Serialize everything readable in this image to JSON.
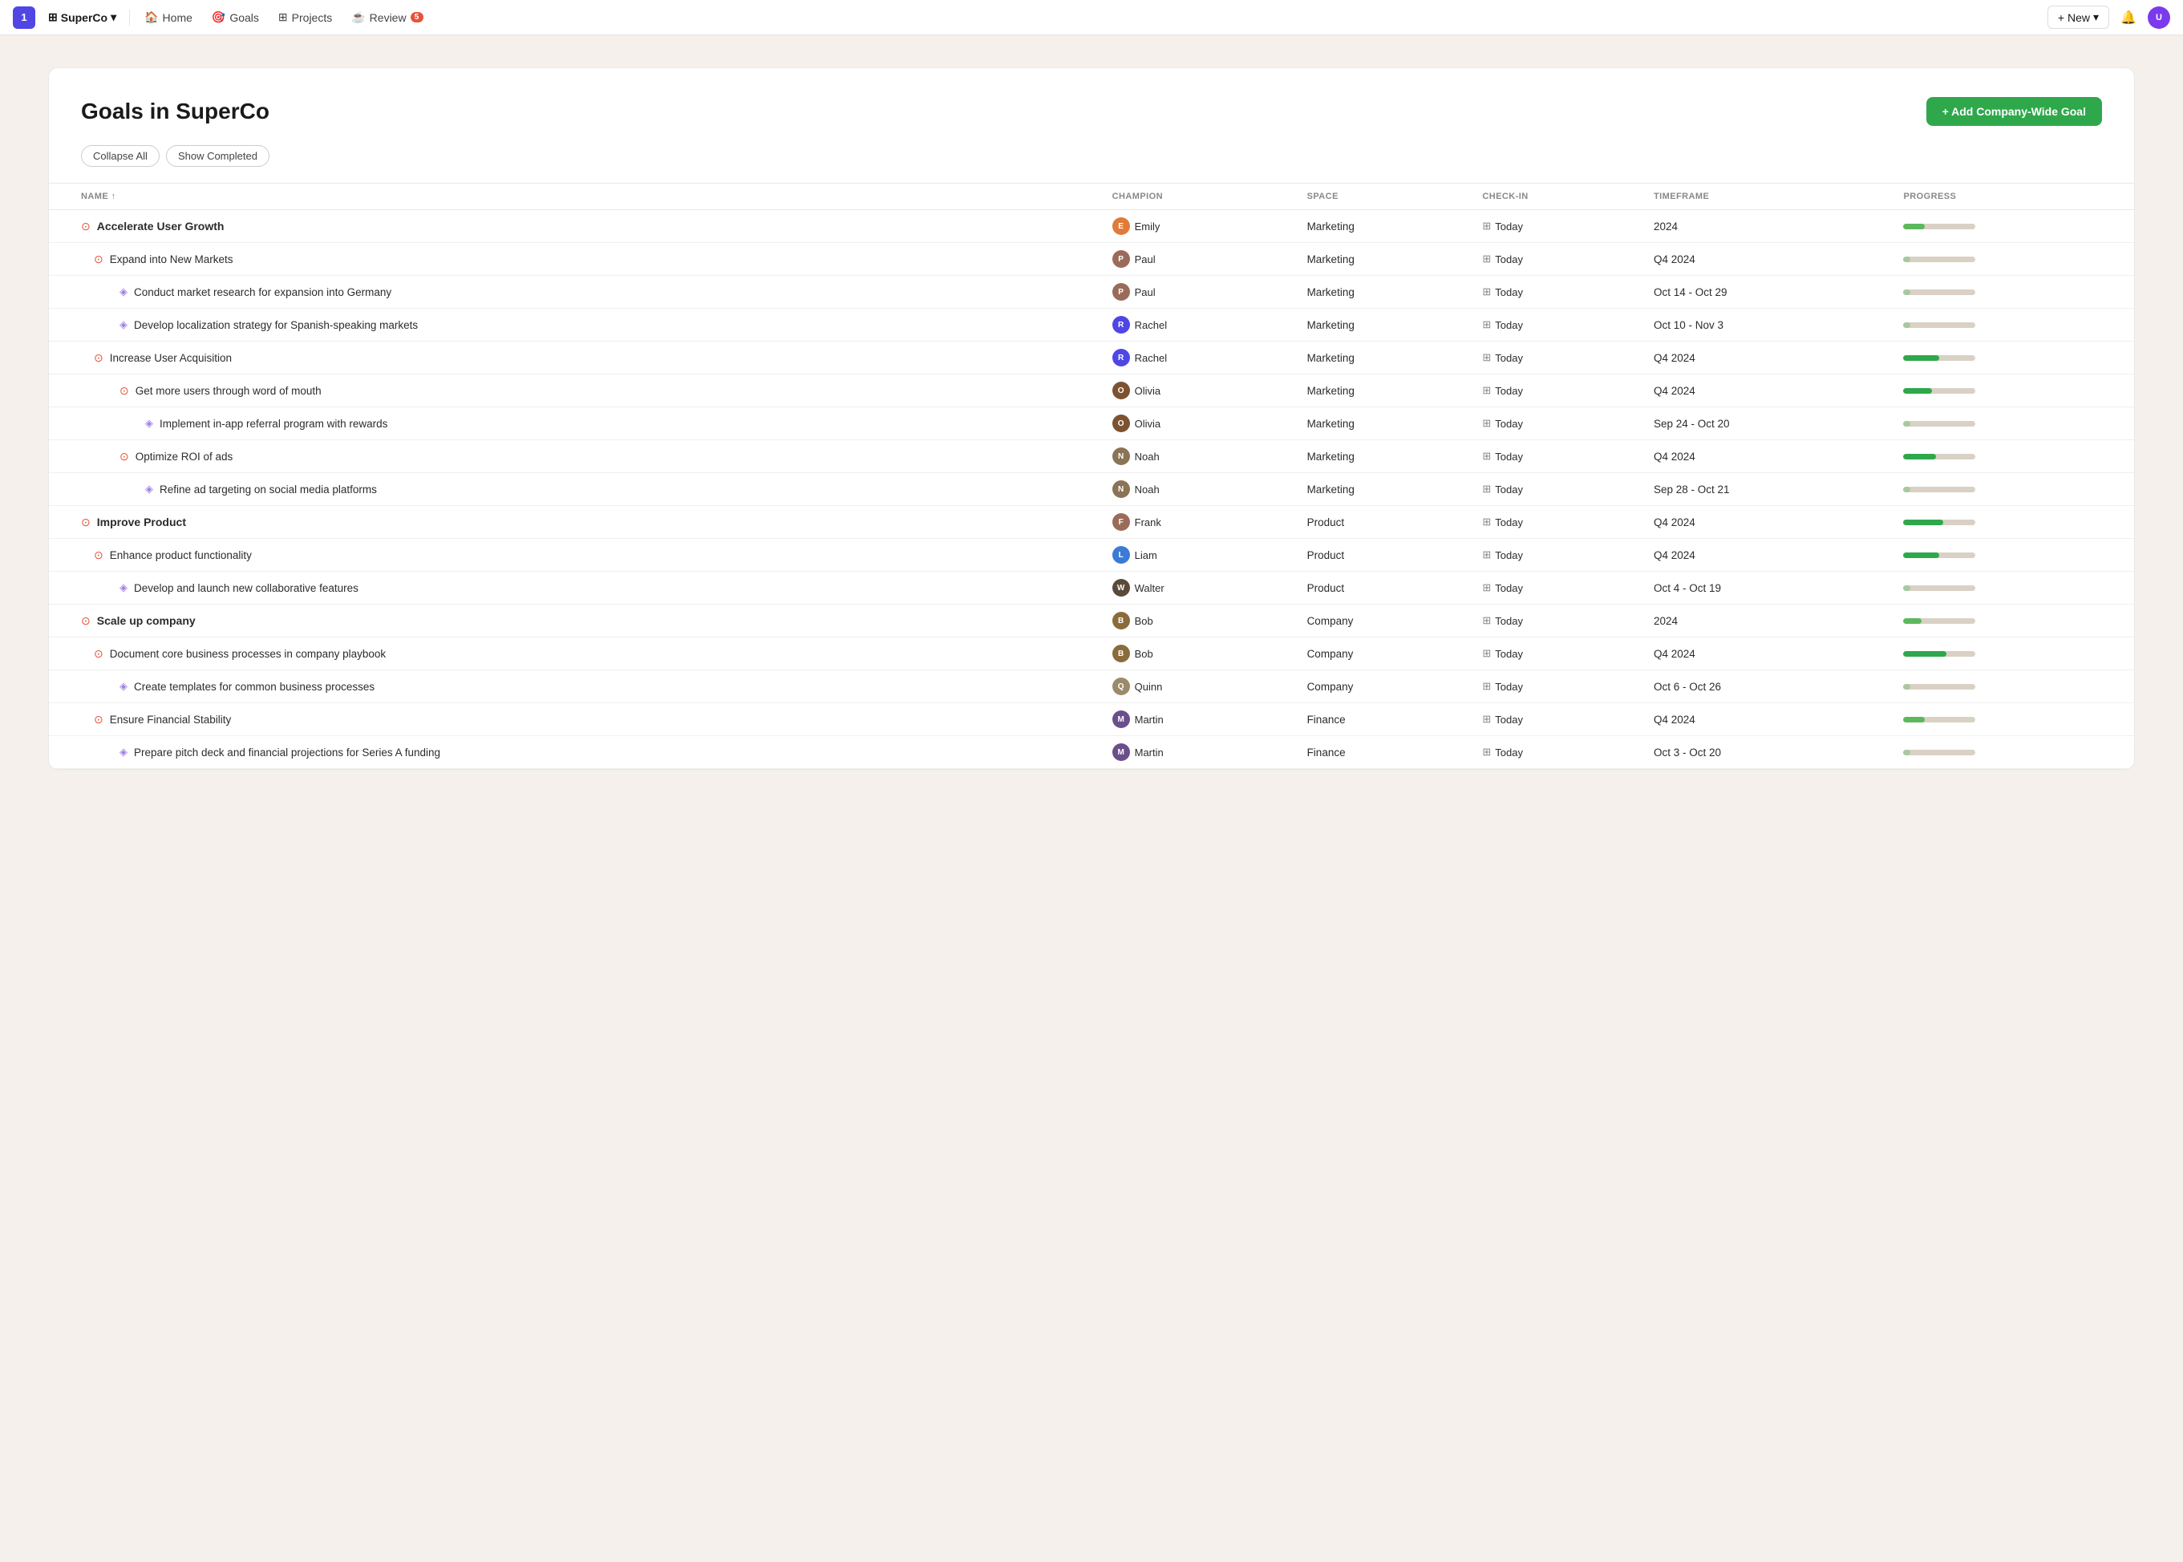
{
  "topnav": {
    "logo": "1",
    "workspace": "SuperCo",
    "workspace_chevron": "▾",
    "nav_items": [
      {
        "label": "Home",
        "icon": "🏠",
        "id": "home"
      },
      {
        "label": "Goals",
        "icon": "🎯",
        "id": "goals"
      },
      {
        "label": "Projects",
        "icon": "⊞",
        "id": "projects"
      },
      {
        "label": "Review",
        "icon": "☕",
        "id": "review",
        "badge": "5"
      }
    ],
    "new_label": "+ New",
    "new_chevron": "▾"
  },
  "goals": {
    "title": "Goals in SuperCo",
    "add_btn": "+ Add Company-Wide Goal",
    "controls": {
      "collapse_all": "Collapse All",
      "show_completed": "Show Completed"
    },
    "columns": [
      "NAME ↑",
      "CHAMPION",
      "SPACE",
      "CHECK-IN",
      "TIMEFRAME",
      "PROGRESS"
    ],
    "rows": [
      {
        "level": 0,
        "type": "goal-bold",
        "icon": "⊙",
        "name": "Accelerate User Growth",
        "champion": "Emily",
        "av_class": "av-emily",
        "champion_icon": "👤",
        "space": "Marketing",
        "checkin": "Today",
        "timeframe": "2024",
        "progress": 30
      },
      {
        "level": 1,
        "type": "goal",
        "icon": "⊙",
        "name": "Expand into New Markets",
        "champion": "Paul",
        "av_class": "av-paul",
        "space": "Marketing",
        "checkin": "Today",
        "timeframe": "Q4 2024",
        "progress": 10
      },
      {
        "level": 2,
        "type": "task",
        "icon": "⬡",
        "name": "Conduct market research for expansion into Germany",
        "champion": "Paul",
        "av_class": "av-paul",
        "space": "Marketing",
        "checkin": "Today",
        "timeframe": "Oct 14 - Oct 29",
        "progress": 10
      },
      {
        "level": 2,
        "type": "task",
        "icon": "⬡",
        "name": "Develop localization strategy for Spanish-speaking markets",
        "champion": "Rachel",
        "av_class": "av-rachel",
        "space": "Marketing",
        "checkin": "Today",
        "timeframe": "Oct 10 - Nov 3",
        "progress": 10
      },
      {
        "level": 1,
        "type": "goal",
        "icon": "⊙",
        "name": "Increase User Acquisition",
        "champion": "Rachel",
        "av_class": "av-rachel",
        "space": "Marketing",
        "checkin": "Today",
        "timeframe": "Q4 2024",
        "progress": 50
      },
      {
        "level": 2,
        "type": "goal",
        "icon": "⊙",
        "name": "Get more users through word of mouth",
        "champion": "Olivia",
        "av_class": "av-olivia",
        "space": "Marketing",
        "checkin": "Today",
        "timeframe": "Q4 2024",
        "progress": 40
      },
      {
        "level": 3,
        "type": "task",
        "icon": "⬡",
        "name": "Implement in-app referral program with rewards",
        "champion": "Olivia",
        "av_class": "av-olivia",
        "space": "Marketing",
        "checkin": "Today",
        "timeframe": "Sep 24 - Oct 20",
        "progress": 10
      },
      {
        "level": 2,
        "type": "goal",
        "icon": "⊙",
        "name": "Optimize ROI of ads",
        "champion": "Noah",
        "av_class": "av-noah",
        "space": "Marketing",
        "checkin": "Today",
        "timeframe": "Q4 2024",
        "progress": 45
      },
      {
        "level": 3,
        "type": "task",
        "icon": "⬡",
        "name": "Refine ad targeting on social media platforms",
        "champion": "Noah",
        "av_class": "av-noah",
        "space": "Marketing",
        "checkin": "Today",
        "timeframe": "Sep 28 - Oct 21",
        "progress": 10
      },
      {
        "level": 0,
        "type": "goal-bold",
        "icon": "⊙",
        "name": "Improve Product",
        "champion": "Frank",
        "av_class": "av-frank",
        "space": "Product",
        "checkin": "Today",
        "timeframe": "Q4 2024",
        "progress": 55
      },
      {
        "level": 1,
        "type": "goal",
        "icon": "⊙",
        "name": "Enhance product functionality",
        "champion": "Liam",
        "av_class": "av-liam",
        "space": "Product",
        "checkin": "Today",
        "timeframe": "Q4 2024",
        "progress": 50
      },
      {
        "level": 2,
        "type": "task",
        "icon": "⬡",
        "name": "Develop and launch new collaborative features",
        "champion": "Walter",
        "av_class": "av-walter",
        "space": "Product",
        "checkin": "Today",
        "timeframe": "Oct 4 - Oct 19",
        "progress": 10
      },
      {
        "level": 0,
        "type": "goal-bold",
        "icon": "⊙",
        "name": "Scale up company",
        "champion": "Bob",
        "av_class": "av-bob",
        "space": "Company",
        "checkin": "Today",
        "timeframe": "2024",
        "progress": 25
      },
      {
        "level": 1,
        "type": "goal",
        "icon": "⊙",
        "name": "Document core business processes in company playbook",
        "champion": "Bob",
        "av_class": "av-bob",
        "space": "Company",
        "checkin": "Today",
        "timeframe": "Q4 2024",
        "progress": 60
      },
      {
        "level": 2,
        "type": "task",
        "icon": "⬡",
        "name": "Create templates for common business processes",
        "champion": "Quinn",
        "av_class": "av-quinn",
        "space": "Company",
        "checkin": "Today",
        "timeframe": "Oct 6 - Oct 26",
        "progress": 10
      },
      {
        "level": 1,
        "type": "goal",
        "icon": "⊙",
        "name": "Ensure Financial Stability",
        "champion": "Martin",
        "av_class": "av-martin",
        "space": "Finance",
        "checkin": "Today",
        "timeframe": "Q4 2024",
        "progress": 30
      },
      {
        "level": 2,
        "type": "task",
        "icon": "⬡",
        "name": "Prepare pitch deck and financial projections for Series A funding",
        "champion": "Martin",
        "av_class": "av-martin",
        "space": "Finance",
        "checkin": "Today",
        "timeframe": "Oct 3 - Oct 20",
        "progress": 10
      }
    ]
  }
}
